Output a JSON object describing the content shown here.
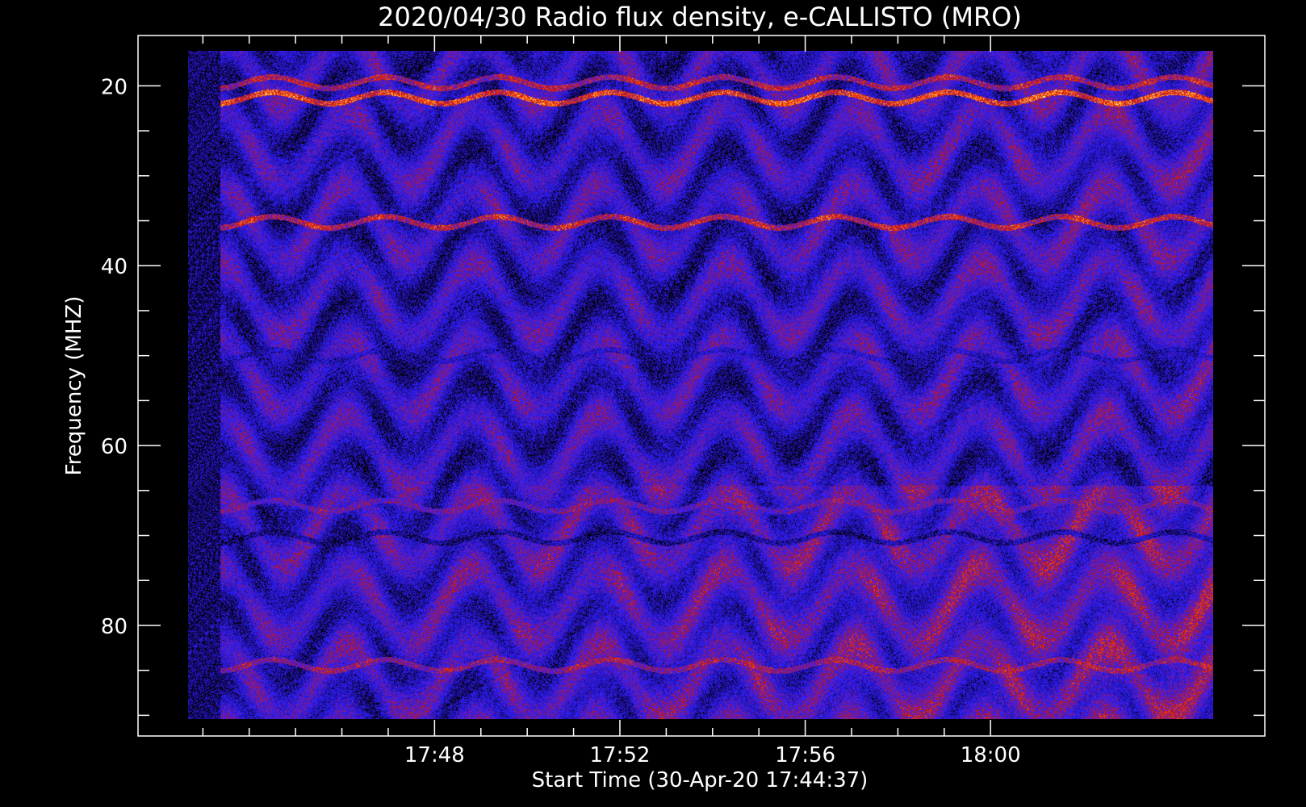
{
  "chart_data": {
    "type": "heatmap",
    "title": "2020/04/30  Radio flux density, e-CALLISTO (MRO)",
    "xlabel": "Start Time (30-Apr-20 17:44:37)",
    "ylabel": "Frequency (MHZ)",
    "x_range_minutes": [
      -3.02,
      21.3
    ],
    "x_data_range_minutes": [
      -2.05,
      15.98
    ],
    "y_range": [
      14.4,
      92.3
    ],
    "y_data_range": [
      16.3,
      90.5
    ],
    "y_inverted": true,
    "x_ticks": [
      {
        "minute": 3.38,
        "label": "17:48"
      },
      {
        "minute": 7.38,
        "label": "17:52"
      },
      {
        "minute": 11.38,
        "label": "17:56"
      },
      {
        "minute": 15.38,
        "label": "18:00"
      }
    ],
    "x_minor_ticks": [
      -1.62,
      -0.62,
      0.38,
      1.38,
      2.38,
      4.38,
      5.38,
      6.38,
      8.38,
      9.38,
      10.38,
      12.38,
      13.38,
      14.38
    ],
    "y_ticks": [
      20,
      40,
      60,
      80
    ],
    "y_minor_ticks": [
      25,
      30,
      35,
      45,
      50,
      55,
      65,
      70,
      75,
      85,
      90
    ],
    "colormap": [
      "#000000",
      "#1a0a8a",
      "#2a1ad0",
      "#3020ff",
      "#7a1a9a",
      "#c01818",
      "#ff4000",
      "#ffb040",
      "#ffffc0"
    ],
    "bands": [
      {
        "freq": 19.8,
        "intensity": 0.75
      },
      {
        "freq": 21.5,
        "intensity": 0.92
      },
      {
        "freq": 35.3,
        "intensity": 0.8
      },
      {
        "freq": 50.1,
        "intensity": 0.2
      },
      {
        "freq": 66.8,
        "intensity": 0.55
      },
      {
        "freq": 70.3,
        "intensity": 0.1
      },
      {
        "freq": 84.5,
        "intensity": 0.65
      }
    ]
  }
}
